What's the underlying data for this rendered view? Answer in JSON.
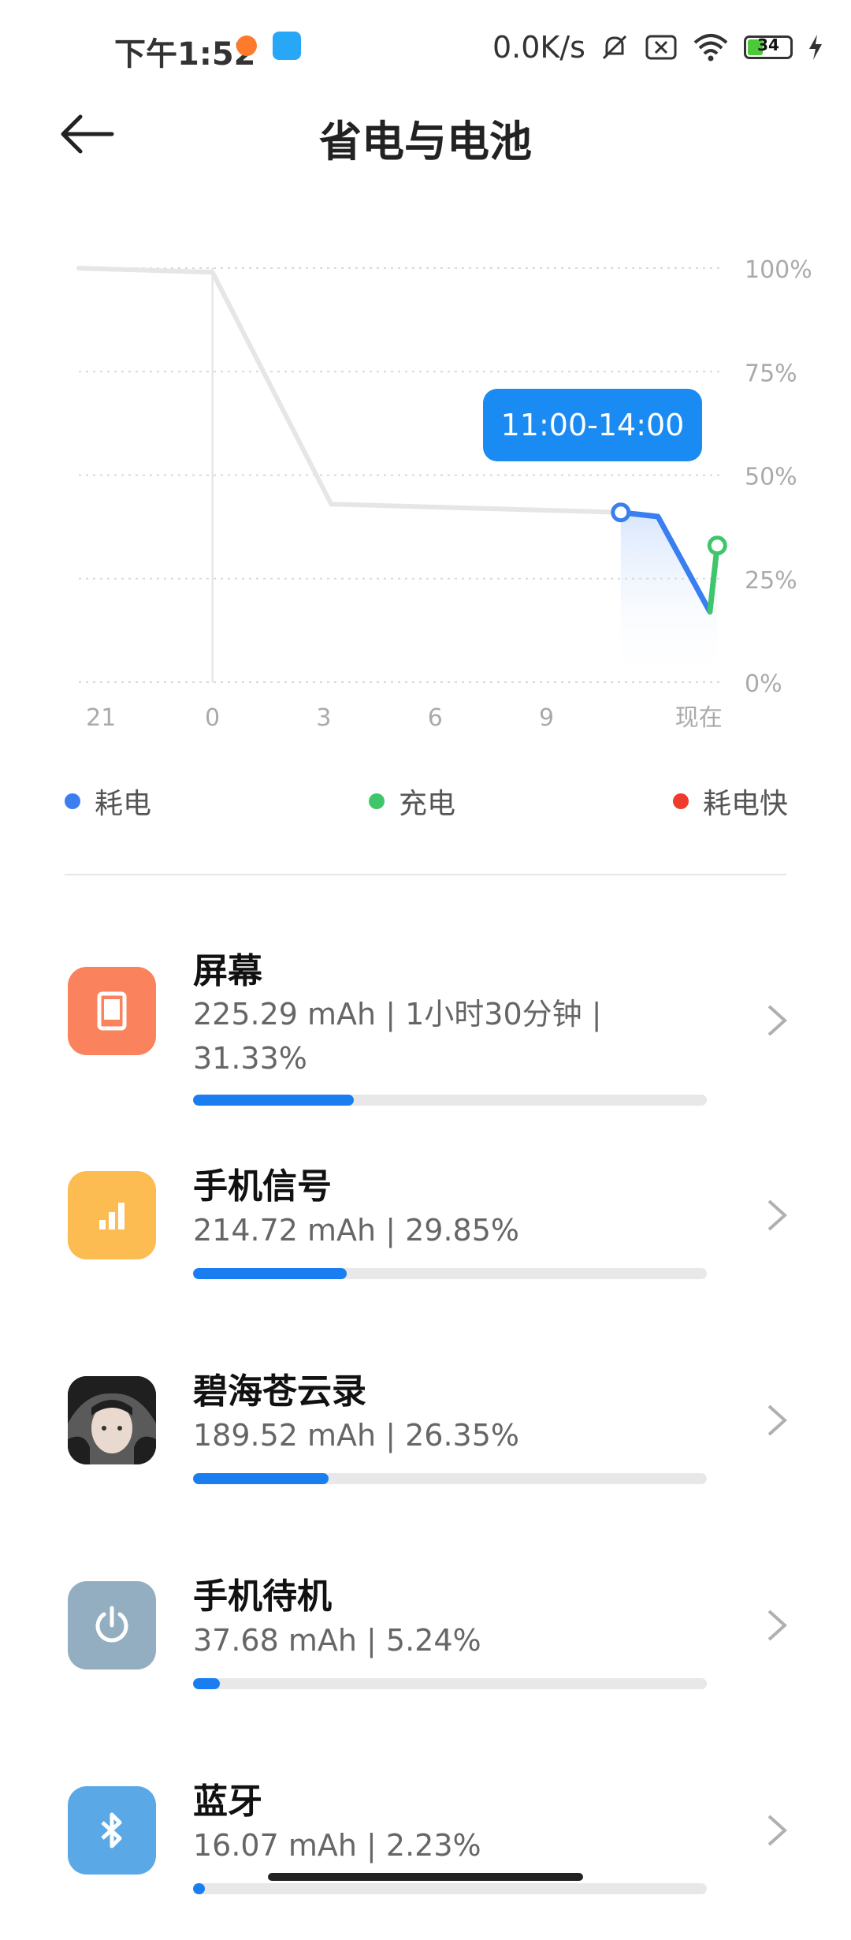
{
  "status_bar": {
    "time": "下午1:52",
    "net_speed": "0.0K/s",
    "battery_level": "34",
    "battery_fraction": 0.34
  },
  "header": {
    "title": "省电与电池"
  },
  "chart_data": {
    "type": "line",
    "x_tick_labels": [
      "21",
      "0",
      "3",
      "6",
      "9",
      "现在"
    ],
    "y_tick_labels": [
      "100%",
      "75%",
      "50%",
      "25%",
      "0%"
    ],
    "ylim": [
      0,
      100
    ],
    "grid": true,
    "tooltip": "11:00-14:00",
    "series": [
      {
        "name": "",
        "color": "#e6e6e6",
        "x": [
          -3.6,
          0.0,
          3.2,
          11.0
        ],
        "y": [
          100,
          99,
          43,
          41
        ]
      },
      {
        "name": "耗电",
        "color": "#3a7ef0",
        "x": [
          11.0,
          12.0,
          13.4
        ],
        "y": [
          41,
          40,
          17
        ]
      },
      {
        "name": "充电",
        "color": "#3fc66a",
        "x": [
          13.4,
          13.6
        ],
        "y": [
          17,
          33
        ]
      }
    ]
  },
  "legend": [
    {
      "label": "耗电",
      "color": "#3a7ef0"
    },
    {
      "label": "充电",
      "color": "#3fc66a"
    },
    {
      "label": "耗电快",
      "color": "#ee3b2b"
    }
  ],
  "usage_list": [
    {
      "name": "屏幕",
      "detail": "225.29 mAh | 1小时30分钟 | 31.33%",
      "fraction": 0.3133,
      "icon": "screen-icon",
      "icon_color": "#fa825d"
    },
    {
      "name": "手机信号",
      "detail": "214.72 mAh | 29.85%",
      "fraction": 0.2985,
      "icon": "signal-icon",
      "icon_color": "#fcbc51"
    },
    {
      "name": "碧海苍云录",
      "detail": "189.52 mAh | 26.35%",
      "fraction": 0.2635,
      "icon": "game-avatar-icon",
      "icon_color": "#4a4a4a"
    },
    {
      "name": "手机待机",
      "detail": "37.68 mAh | 5.24%",
      "fraction": 0.0524,
      "icon": "power-icon",
      "icon_color": "#93aec0"
    },
    {
      "name": "蓝牙",
      "detail": "16.07 mAh | 2.23%",
      "fraction": 0.0223,
      "icon": "bluetooth-icon",
      "icon_color": "#5aa8e6"
    }
  ]
}
